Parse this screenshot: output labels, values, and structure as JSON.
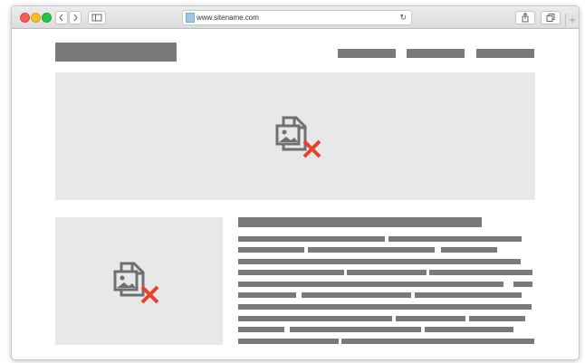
{
  "browser": {
    "url": "www.sitename.com",
    "reload_icon": "reload-icon",
    "new_tab_icon": "plus-icon"
  },
  "placeholders": {
    "broken_image_icon": "broken-image-icon"
  },
  "colors": {
    "placeholder_fill": "#e8e8e8",
    "placeholder_bar": "#7a7a7a",
    "error_x": "#e8412b"
  }
}
